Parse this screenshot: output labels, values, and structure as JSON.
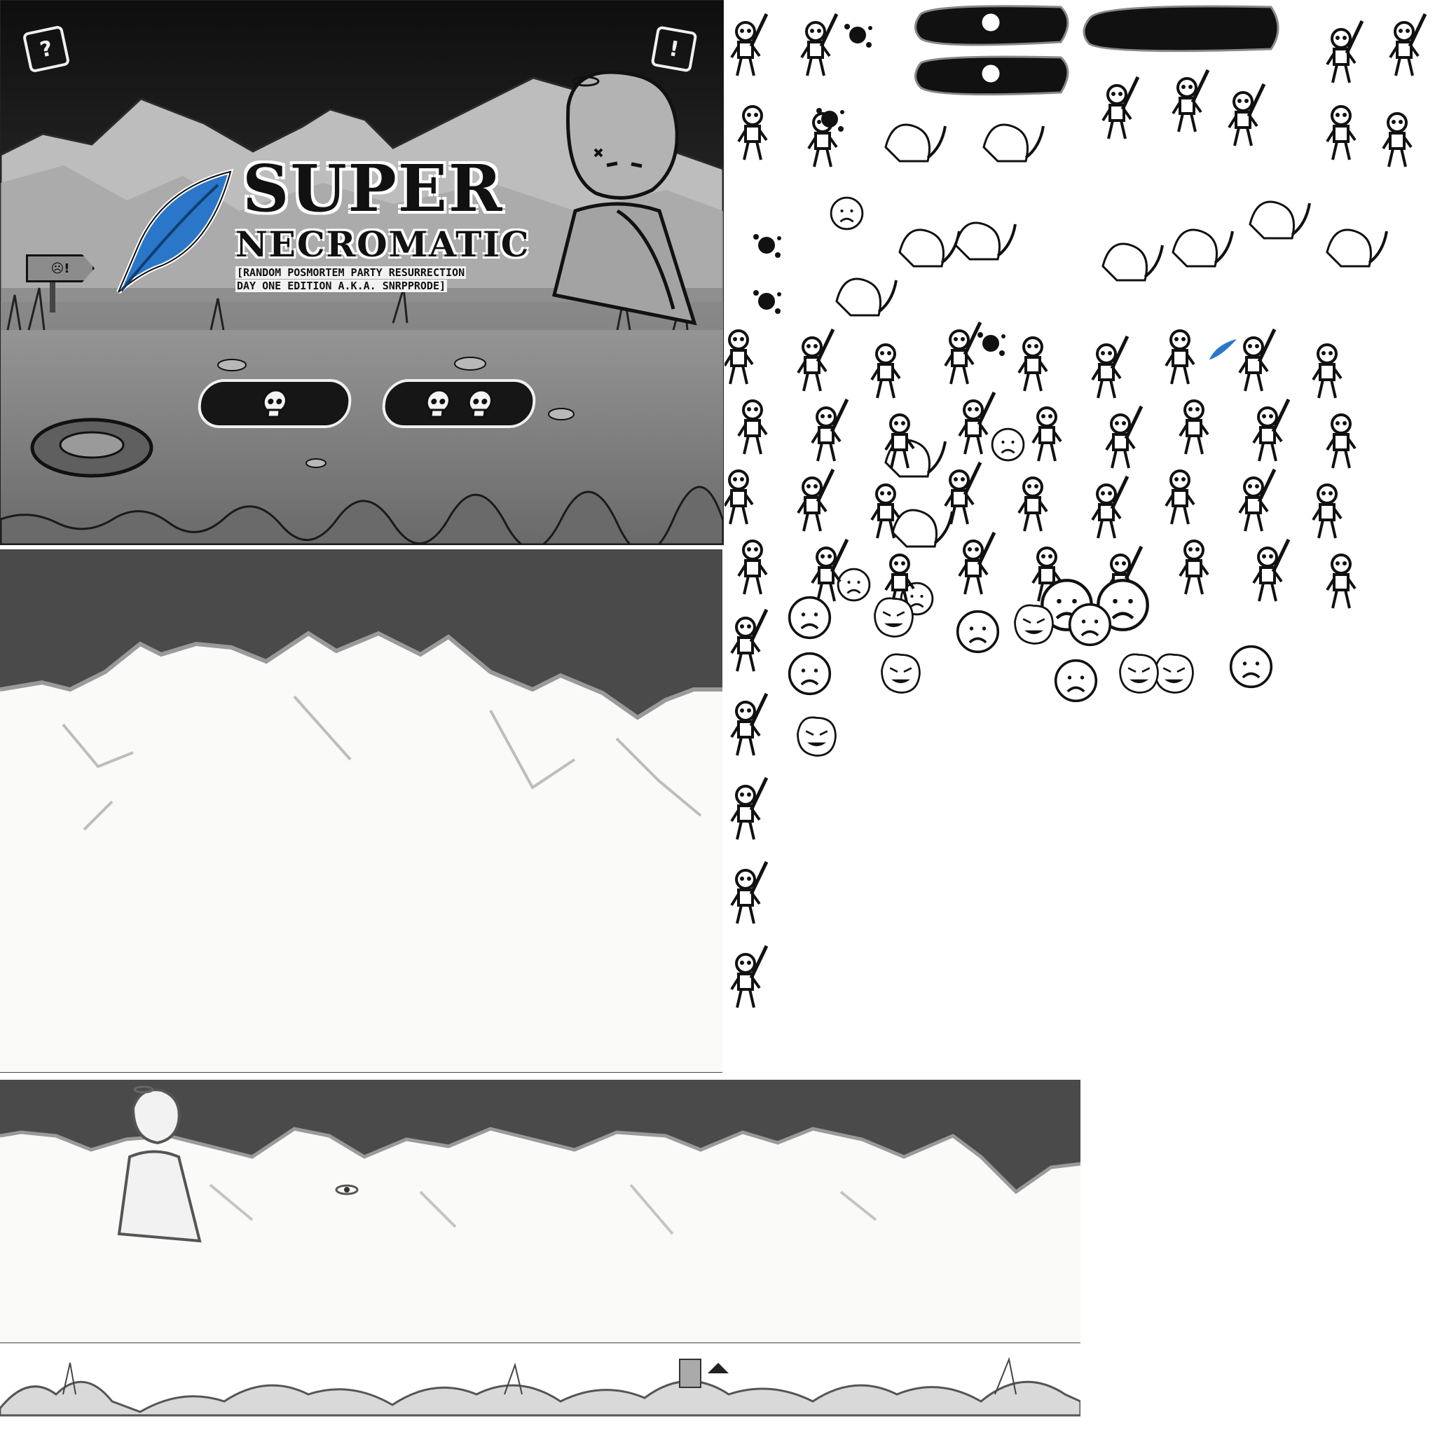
{
  "title_screen": {
    "title_line1": "SUPER",
    "title_line2": "NECROMATIC",
    "subtitle_line1": "[RANDOM POSMORTEM PARTY RESURRECTION",
    "subtitle_line2": "DAY ONE EDITION A.K.A. SNRPPRODE]",
    "help_button_symbol": "?",
    "info_button_symbol": "!",
    "signpost_symbol": "☹!",
    "one_player_button": "one-skull-icon",
    "two_player_button": "two-skull-icon"
  },
  "colors": {
    "sky_dark": "#1c1c1c",
    "sky_gray": "#4b4b4b",
    "ground_gray": "#8d8d8d",
    "feather_blue": "#2a77c9",
    "ink": "#111111"
  },
  "sprite_sheet": {
    "buttons": [
      "skull-button",
      "skull-button",
      "blank-button"
    ],
    "sprites": [
      "skeleton",
      "skeleton-with-sword",
      "brain-skeleton",
      "cloaked-rat-creature",
      "ghost-face",
      "blood-splat",
      "blue-feather",
      "sad-face",
      "angry-face"
    ]
  }
}
